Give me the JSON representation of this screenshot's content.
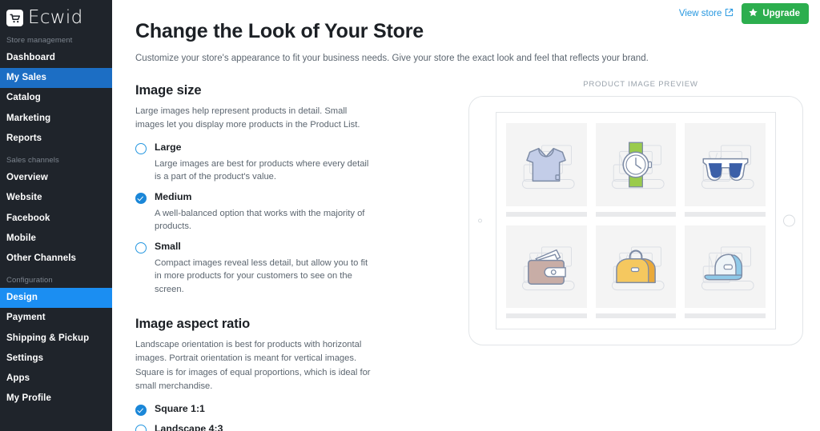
{
  "brand": {
    "name": "Ecwid",
    "logo_icon": "shopping-cart-icon"
  },
  "sidebar": {
    "groups": [
      {
        "title": "Store management",
        "items": [
          {
            "label": "Dashboard",
            "active": false
          },
          {
            "label": "My Sales",
            "active": true
          },
          {
            "label": "Catalog",
            "active": false
          },
          {
            "label": "Marketing",
            "active": false
          },
          {
            "label": "Reports",
            "active": false
          }
        ]
      },
      {
        "title": "Sales channels",
        "items": [
          {
            "label": "Overview",
            "active": false
          },
          {
            "label": "Website",
            "active": false
          },
          {
            "label": "Facebook",
            "active": false
          },
          {
            "label": "Mobile",
            "active": false
          },
          {
            "label": "Other Channels",
            "active": false
          }
        ]
      },
      {
        "title": "Configuration",
        "items": [
          {
            "label": "Design",
            "active": true
          },
          {
            "label": "Payment",
            "active": false
          },
          {
            "label": "Shipping & Pickup",
            "active": false
          },
          {
            "label": "Settings",
            "active": false
          },
          {
            "label": "Apps",
            "active": false
          },
          {
            "label": "My Profile",
            "active": false
          }
        ]
      }
    ]
  },
  "topbar": {
    "view_store_label": "View store",
    "view_store_icon": "external-link-icon",
    "upgrade_label": "Upgrade",
    "upgrade_icon": "star-icon",
    "upgrade_color": "#2cae4e",
    "link_color": "#2597e0"
  },
  "page": {
    "title": "Change the Look of Your Store",
    "subtitle": "Customize your store's appearance to fit your business needs. Give your store the exact look and feel that reflects your brand."
  },
  "image_size": {
    "heading": "Image size",
    "description": "Large images help represent products in detail. Small images let you display more products in the Product List.",
    "options": [
      {
        "label": "Large",
        "description": "Large images are best for products where every detail is a part of the product's value.",
        "selected": false
      },
      {
        "label": "Medium",
        "description": "A well-balanced option that works with the majority of products.",
        "selected": true
      },
      {
        "label": "Small",
        "description": "Compact images reveal less detail, but allow you to fit in more products for your customers to see on the screen.",
        "selected": false
      }
    ]
  },
  "aspect_ratio": {
    "heading": "Image aspect ratio",
    "description": "Landscape orientation is best for products with horizontal images. Portrait orientation is meant for vertical images. Square is for images of equal proportions, which is ideal for small merchandise.",
    "options": [
      {
        "label": "Square 1:1",
        "selected": true
      },
      {
        "label": "Landscape 4:3",
        "selected": false
      }
    ]
  },
  "preview": {
    "title": "PRODUCT IMAGE PREVIEW",
    "device": "tablet",
    "tiles": [
      {
        "icon": "tshirt-icon",
        "color": "#c3cde8"
      },
      {
        "icon": "watch-icon",
        "color": "#9acb4c"
      },
      {
        "icon": "sunglasses-icon",
        "color": "#3b5fa8"
      },
      {
        "icon": "wallet-icon",
        "color": "#c8ada6"
      },
      {
        "icon": "handbag-icon",
        "color": "#f5c85f"
      },
      {
        "icon": "cap-icon",
        "color": "#8fc9e8"
      }
    ]
  }
}
